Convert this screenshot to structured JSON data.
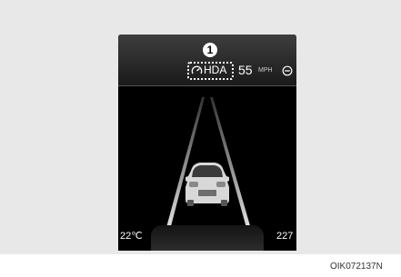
{
  "cluster": {
    "callout_number": "1",
    "hda_label": "HDA",
    "set_speed": "55",
    "speed_unit": "MPH",
    "outside_temp": "22℃",
    "odometer": "227"
  },
  "icons": {
    "gauge": "speedometer-icon",
    "speed_set": "set-speed-icon",
    "vehicle": "car-icon"
  },
  "caption": "OIK072137N"
}
